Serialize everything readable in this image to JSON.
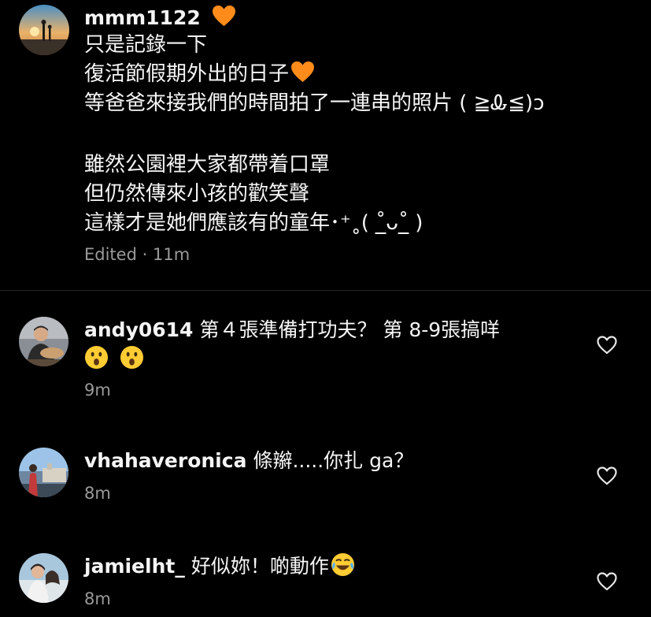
{
  "post": {
    "username": "mmm1122",
    "username_emoji": "orange-heart-icon",
    "lines": [
      "只是記錄一下",
      "復活節假期外出的日子",
      "等爸爸來接我們的時間拍了一連串的照片 ( ≧Ꮂ≦)ɔ",
      "",
      "雖然公園裡大家都帶着口罩",
      "但仍然傳來小孩的歡笑聲",
      "這樣才是她們應該有的童年･⁺˳( ˚̲̲̲̲̲̲̲̲̲̲̲̲̲̲̲ᴗ˚̲̲̲ )"
    ],
    "line2_emoji": "orange-heart-icon",
    "edited_label": "Edited",
    "separator": "·",
    "time": "11m"
  },
  "comments": [
    {
      "username": "andy0614",
      "text": "第４張準備打功夫？ 第 8-9張搞咩",
      "emojis": [
        "astonished-face-icon",
        "astonished-face-icon"
      ],
      "time": "9m"
    },
    {
      "username": "vhahaveronica",
      "text": "條辮.....你扎 ga？",
      "emojis": [],
      "time": "8m"
    },
    {
      "username": "jamielht_",
      "text": "好似妳！啲動作",
      "emojis": [
        "face-with-tears-of-joy-icon"
      ],
      "time": "8m"
    }
  ],
  "colors": {
    "background": "#000000",
    "text": "#f5f5f5",
    "secondary_text": "#9a9a9a",
    "orange_heart": "#ff8c1a",
    "divider": "#262626"
  }
}
